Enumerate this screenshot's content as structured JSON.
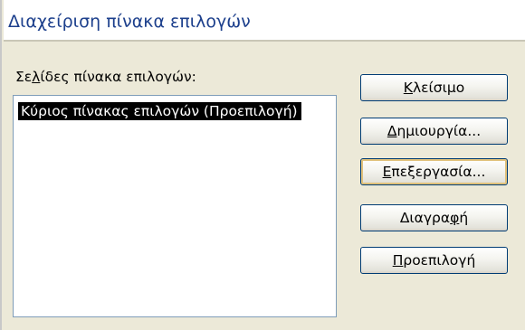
{
  "window": {
    "title": "Διαχείριση πίνακα επιλογών"
  },
  "list": {
    "label_pre": "Σε",
    "label_mnemonic": "λ",
    "label_post": "ίδες πίνακα επιλογών:",
    "items": [
      {
        "label": "Κύριος πίνακας επιλογών (Προεπιλογή)",
        "selected": true
      }
    ]
  },
  "buttons": {
    "close": {
      "pre": "",
      "mnemonic": "Κ",
      "post": "λείσιμο"
    },
    "new": {
      "pre": "",
      "mnemonic": "Δ",
      "post": "ημιουργία..."
    },
    "edit": {
      "pre": "",
      "mnemonic": "Ε",
      "post": "πεξεργασία..."
    },
    "delete": {
      "pre": "Διαγρα",
      "mnemonic": "φ",
      "post": "ή"
    },
    "default": {
      "pre": "",
      "mnemonic": "Π",
      "post": "ροεπιλογή"
    }
  },
  "colors": {
    "title_text": "#1c3f8c",
    "dialog_background": "#ece9d8",
    "selection_background": "#000000",
    "selection_text": "#ffffff",
    "button_border": "#003c74",
    "focus_ring": "#e1c17a"
  }
}
